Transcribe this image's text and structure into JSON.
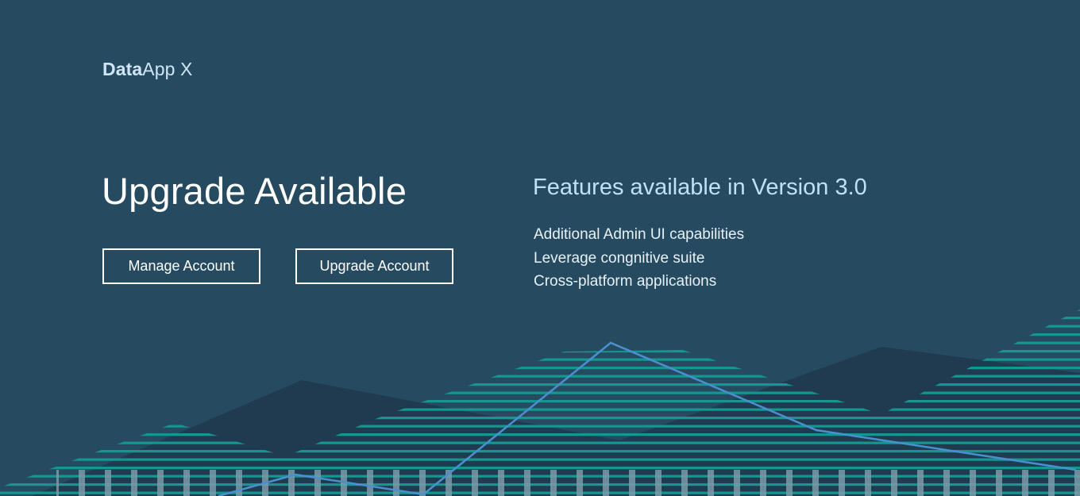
{
  "header": {
    "brand_bold": "Data",
    "brand_rest": "App X"
  },
  "main": {
    "title": "Upgrade Available",
    "buttons": {
      "manage_label": "Manage Account",
      "upgrade_label": "Upgrade Account"
    }
  },
  "features": {
    "title": "Features available in Version 3.0",
    "items": [
      "Additional Admin UI capabilities",
      "Leverage congnitive suite",
      "Cross-platform applications"
    ]
  },
  "colors": {
    "background": "#264a60",
    "mountain_dark": "#203b4f",
    "stripe_teal": "#129c94",
    "line_blue": "#4a90d0",
    "bar_light": "#7a9aa8"
  }
}
